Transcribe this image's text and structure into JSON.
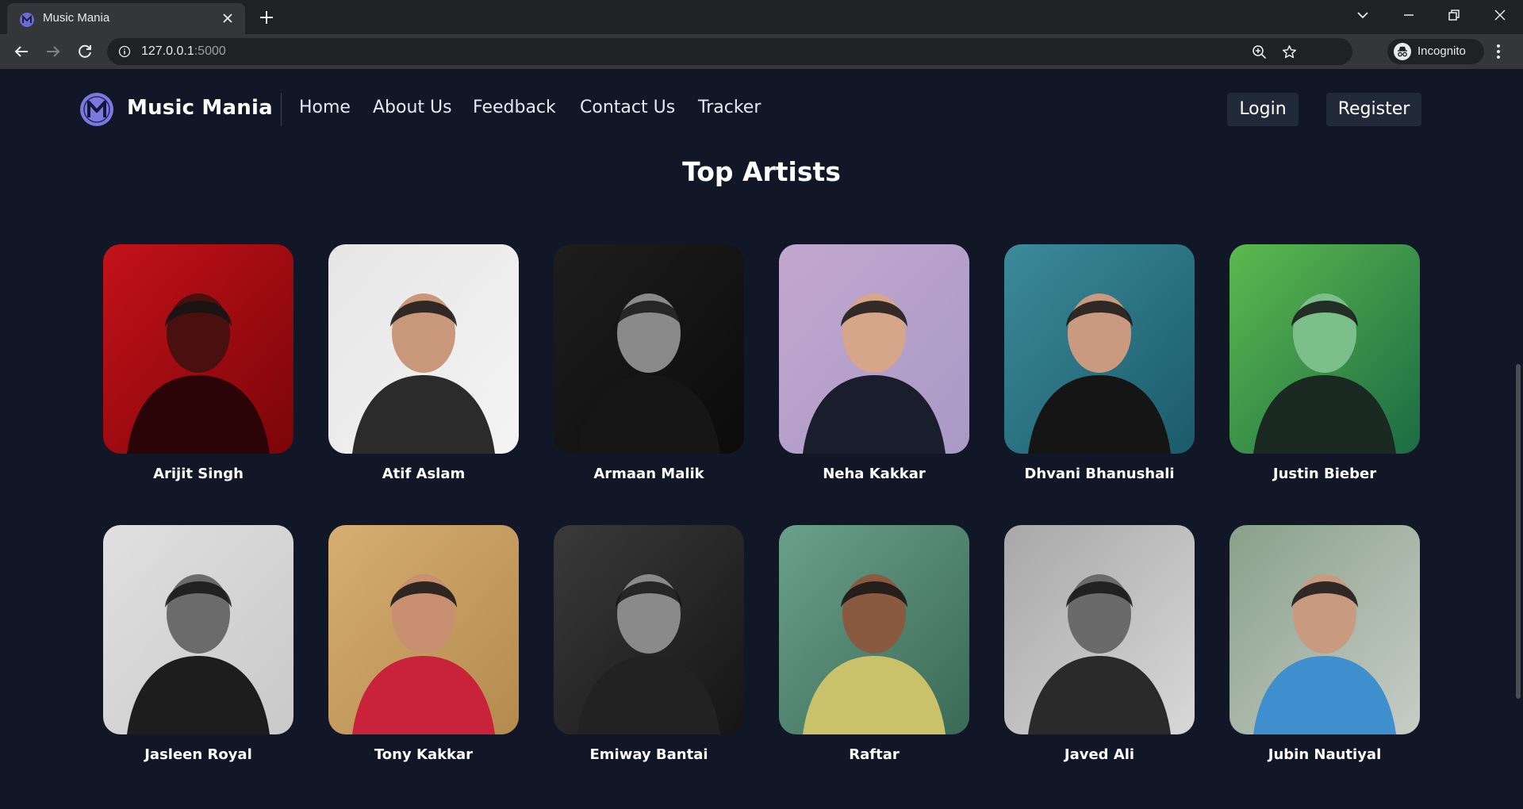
{
  "browser": {
    "tab_title": "Music Mania",
    "url_host": "127.0.0.1",
    "url_port": ":5000",
    "profile_label": "Incognito"
  },
  "site": {
    "brand": "Music Mania",
    "nav": [
      "Home",
      "About Us",
      "Feedback",
      "Contact Us",
      "Tracker"
    ],
    "login_label": "Login",
    "register_label": "Register",
    "section_title": "Top Artists"
  },
  "artists": [
    {
      "name": "Arijit Singh",
      "bg": "#7a0508",
      "mid": "#c4121a",
      "skin": "#4a1010",
      "cloth": "#2a0406"
    },
    {
      "name": "Atif Aslam",
      "bg": "#f4f4f4",
      "mid": "#e6e6e6",
      "skin": "#c9977a",
      "cloth": "#2b2b2b"
    },
    {
      "name": "Armaan Malik",
      "bg": "#0b0b0b",
      "mid": "#1e1e1e",
      "skin": "#8a8a8a",
      "cloth": "#161616"
    },
    {
      "name": "Neha Kakkar",
      "bg": "#a89ac6",
      "mid": "#c3a7cf",
      "skin": "#d6a58a",
      "cloth": "#1a1d2c"
    },
    {
      "name": "Dhvani Bhanushali",
      "bg": "#1b5b6a",
      "mid": "#3b8a9a",
      "skin": "#c99a80",
      "cloth": "#151515"
    },
    {
      "name": "Justin Bieber",
      "bg": "#1c6b44",
      "mid": "#5cba4e",
      "skin": "#7cbf8a",
      "cloth": "#1a2a22"
    },
    {
      "name": "Jasleen Royal",
      "bg": "#c9c9c9",
      "mid": "#e0e0e0",
      "skin": "#6b6b6b",
      "cloth": "#1d1d1d"
    },
    {
      "name": "Tony Kakkar",
      "bg": "#b58a4e",
      "mid": "#d6ae72",
      "skin": "#c89070",
      "cloth": "#c8233a"
    },
    {
      "name": "Emiway Bantai",
      "bg": "#151515",
      "mid": "#3a3a3a",
      "skin": "#8a8a8a",
      "cloth": "#222222"
    },
    {
      "name": "Raftar",
      "bg": "#3a6a55",
      "mid": "#6aa08a",
      "skin": "#8a5a40",
      "cloth": "#c9c26a"
    },
    {
      "name": "Javed Ali",
      "bg": "#d8d8d8",
      "mid": "#a8a8a8",
      "skin": "#6a6a6a",
      "cloth": "#2a2a2a"
    },
    {
      "name": "Jubin Nautiyal",
      "bg": "#c6cdc6",
      "mid": "#8aa08a",
      "skin": "#c89a80",
      "cloth": "#3f8fcf"
    }
  ]
}
